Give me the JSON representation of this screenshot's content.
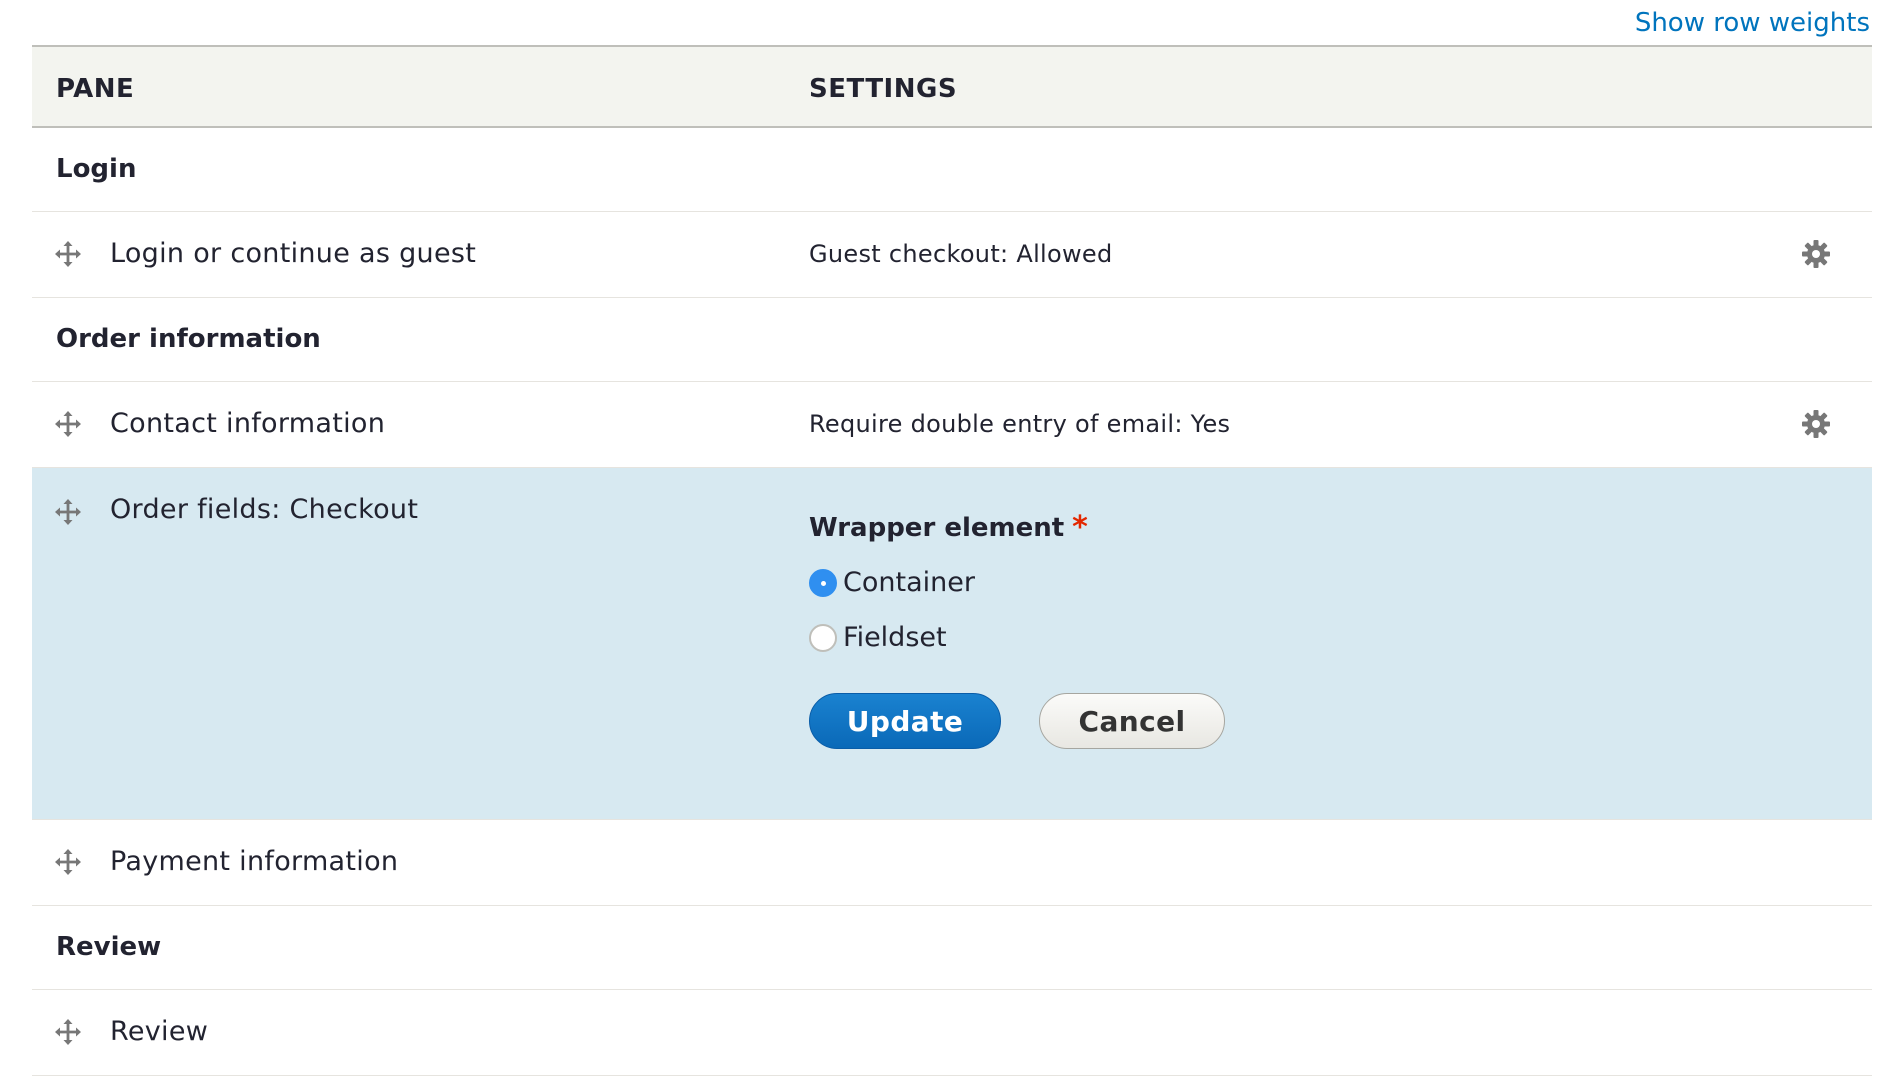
{
  "header_link": "Show row weights",
  "table": {
    "col_pane": "PANE",
    "col_settings": "SETTINGS"
  },
  "regions": {
    "login": "Login",
    "order_information": "Order information",
    "review": "Review"
  },
  "panes": {
    "login_guest": {
      "label": "Login or continue as guest",
      "summary": "Guest checkout: Allowed"
    },
    "contact": {
      "label": "Contact information",
      "summary": "Require double entry of email: Yes"
    },
    "order_fields": {
      "label": "Order fields: Checkout"
    },
    "payment": {
      "label": "Payment information"
    },
    "review": {
      "label": "Review"
    }
  },
  "edit_form": {
    "field_label": "Wrapper element",
    "required_marker": "*",
    "options": [
      "Container",
      "Fieldset"
    ],
    "selected": "Container",
    "update_label": "Update",
    "cancel_label": "Cancel"
  },
  "colors": {
    "link": "#0074bd",
    "edit_row_bg": "#d7e9f1",
    "primary_button": "#0a69b8",
    "required": "#e32700"
  },
  "icons": {
    "drag": "move-arrows-icon",
    "settings": "gear-icon"
  }
}
